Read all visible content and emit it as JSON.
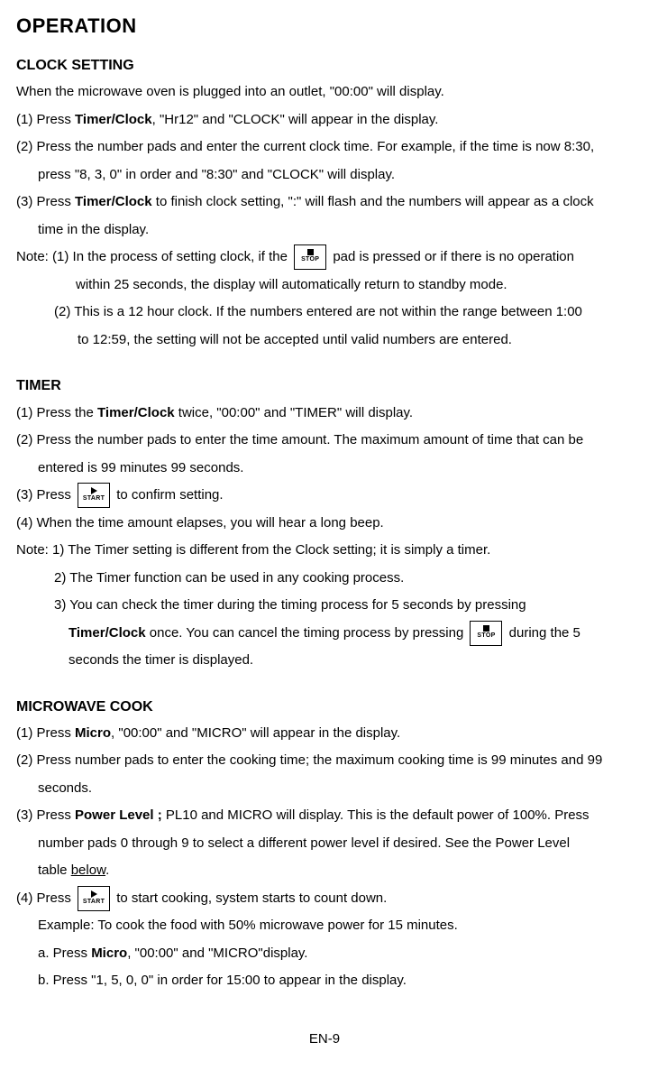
{
  "title": "OPERATION",
  "clock": {
    "heading": "CLOCK SETTING",
    "intro": "When the microwave oven is plugged into an outlet, \"00:00\" will display.",
    "step1a": "(1) Press ",
    "step1_bold": "Timer/Clock",
    "step1b": ", \"Hr12\" and \"CLOCK\" will appear in the display.",
    "step2a": "(2) Press the number pads and enter the current clock time. For example, if the time is now 8:30,",
    "step2b": "press \"8, 3, 0\" in order and \"8:30\" and \"CLOCK\" will display.",
    "step3a": "(3) Press ",
    "step3_bold": "Timer/Clock",
    "step3b": " to finish clock setting, \":\" will flash and the numbers will appear as a clock",
    "step3c": "time in the display.",
    "note_label": "Note: ",
    "note1a": "(1) In the process of setting clock, if the ",
    "note1b": " pad is pressed or if there is no operation",
    "note1c": "within 25 seconds, the display will automatically return to standby mode.",
    "note2a": "(2) This is a 12 hour clock. If the numbers entered are not within the range between 1:00",
    "note2b": "to 12:59, the setting will not be accepted until valid numbers are entered."
  },
  "timer": {
    "heading": "TIMER",
    "step1a": "(1) Press the ",
    "step1_bold": "Timer/Clock",
    "step1b": " twice, \"00:00\" and \"TIMER\" will display.",
    "step2a": "(2) Press the number pads to enter the time amount. The maximum amount of time that can be",
    "step2b": "entered is 99 minutes 99 seconds.",
    "step3a": "(3) Press ",
    "step3b": " to confirm setting.",
    "step4": "(4) When the time amount elapses, you will hear a long beep.",
    "note_label": "Note: ",
    "note1": "1) The Timer setting is different from the Clock setting; it is simply a timer.",
    "note2": "2) The Timer function can be used in any cooking process.",
    "note3": "3) You can check the timer during the timing process for 5 seconds by pressing",
    "note3b_bold": "Timer/Clock",
    "note3b": " once. You can cancel the timing process by pressing ",
    "note3c": " during the 5",
    "note3d": "seconds the timer is displayed."
  },
  "micro": {
    "heading": "MICROWAVE COOK",
    "step1a": "(1) Press ",
    "step1_bold": "Micro",
    "step1b": ", \"00:00\" and \"MICRO\" will appear in the display.",
    "step2a": "(2) Press number pads to enter the cooking time; the maximum cooking time is 99 minutes and 99",
    "step2b": "seconds.",
    "step3a": "(3) Press ",
    "step3_bold": "Power Level ;",
    "step3b": " PL10 and MICRO will display. This is the default power of 100%. Press",
    "step3c": "number pads 0 through 9 to select a different power level if desired. See the Power Level",
    "step3d_a": "table ",
    "step3d_u": "below",
    "step3d_b": ".",
    "step4a": "(4) Press ",
    "step4b": " to start cooking, system starts to count down.",
    "exa": "Example: To cook the food with 50% microwave power for 15 minutes.",
    "exb_a": "a. Press ",
    "exb_bold": "Micro",
    "exb_b": ", \"00:00\" and \"MICRO\"display.",
    "exc": "b. Press \"1, 5, 0, 0\" in order for 15:00 to appear in the display."
  },
  "buttons": {
    "stop": "STOP",
    "start": "START"
  },
  "pagenum": "EN-9"
}
